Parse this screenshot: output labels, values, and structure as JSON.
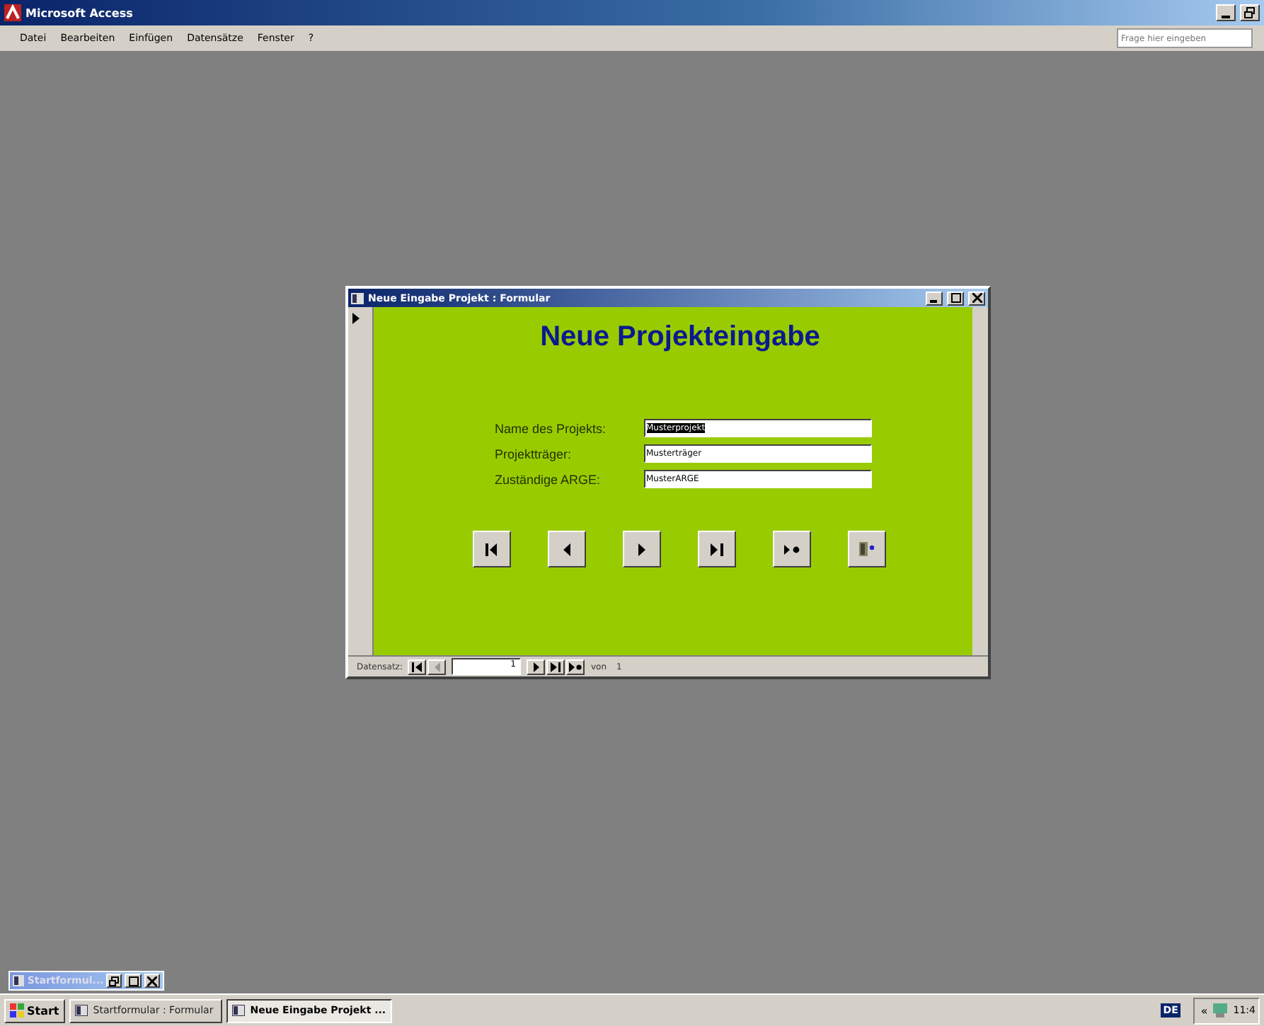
{
  "window": {
    "title": "Microsoft Access"
  },
  "menu": [
    "Datei",
    "Bearbeiten",
    "Einfügen",
    "Datensätze",
    "Fenster",
    "?"
  ],
  "help_box": {
    "placeholder": "Frage hier eingeben"
  },
  "form": {
    "title": "Neue Eingabe Projekt : Formular",
    "heading": "Neue Projekteingabe",
    "fields": [
      {
        "label": "Name des Projekts:",
        "value": "Musterprojekt",
        "selected": true
      },
      {
        "label": "Projektträger:",
        "value": "Musterträger",
        "selected": false
      },
      {
        "label": "Zuständige ARGE:",
        "value": "MusterARGE",
        "selected": false
      }
    ],
    "buttons": [
      {
        "kind": "first"
      },
      {
        "kind": "prev"
      },
      {
        "kind": "next"
      },
      {
        "kind": "last"
      },
      {
        "kind": "new"
      },
      {
        "kind": "exit"
      }
    ],
    "record_nav": {
      "label": "Datensatz:",
      "value": "1",
      "of": "von",
      "total": "1",
      "prev_disabled": true
    }
  },
  "minimized": {
    "title": "Startformul..."
  },
  "taskbar": {
    "start": "Start",
    "tasks": [
      {
        "label": "Startformular : Formular",
        "selected": false
      },
      {
        "label": "Neue Eingabe Projekt ...",
        "selected": true
      }
    ],
    "language": "DE",
    "chevron": "«",
    "clock": "11:4"
  }
}
